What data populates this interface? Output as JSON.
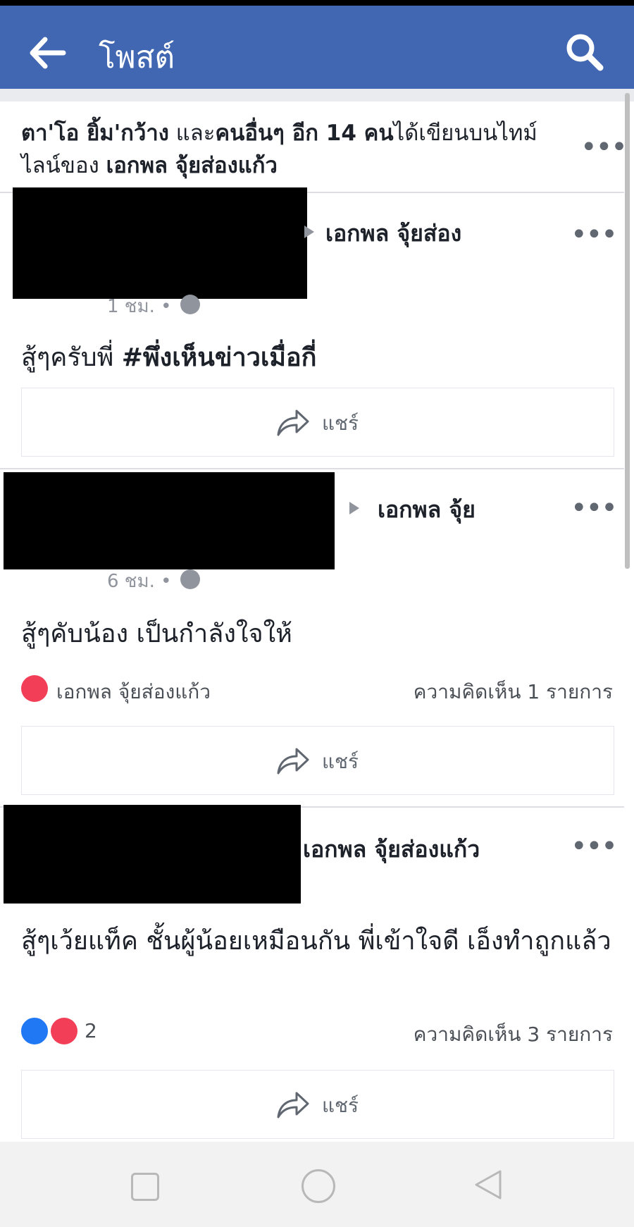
{
  "header": {
    "title": "โพสต์",
    "back_icon": "arrow-left-icon",
    "search_icon": "search-icon",
    "color": "#4267b2"
  },
  "summary": {
    "name1": "ตา'โอ ยิ้ม'กว้าง",
    "and": " และ",
    "others": "คนอื่นๆ อีก 14 คน",
    "wrote_on": "ได้เขียนบนไทม์ไลน์ของ ",
    "owner": "เอกพล จุ้ยส่องแก้ว"
  },
  "posts": [
    {
      "author": "เอกพล จุ้ยส่อง",
      "time": "1 ชม. •",
      "text_plain": "สู้ๆครับพี่ ",
      "text_tag": "#พึ่งเห็นข่าวเมื่อกี่",
      "share_label": "แชร์"
    },
    {
      "author": "เอกพล จุ้ย",
      "time": "6 ชม. •",
      "text": "สู้ๆคับน้อง เป็นกำลังใจให้",
      "reaction_name": "เอกพล จุ้ยส่องแก้ว",
      "comments": "ความคิดเห็น 1 รายการ",
      "share_label": "แชร์"
    },
    {
      "author": "เอกพล จุ้ยส่องแก้ว",
      "text": "สู้ๆเว้ยแท็ค ชั้นผู้น้อยเหมือนกัน พี่เข้าใจดี เอ็งทำถูกแล้ว",
      "reaction_count": "2",
      "comments": "ความคิดเห็น 3 รายการ",
      "share_label": "แชร์"
    }
  ],
  "navbar": {
    "recent_icon": "square-icon",
    "home_icon": "circle-icon",
    "back_icon": "triangle-back-icon"
  }
}
